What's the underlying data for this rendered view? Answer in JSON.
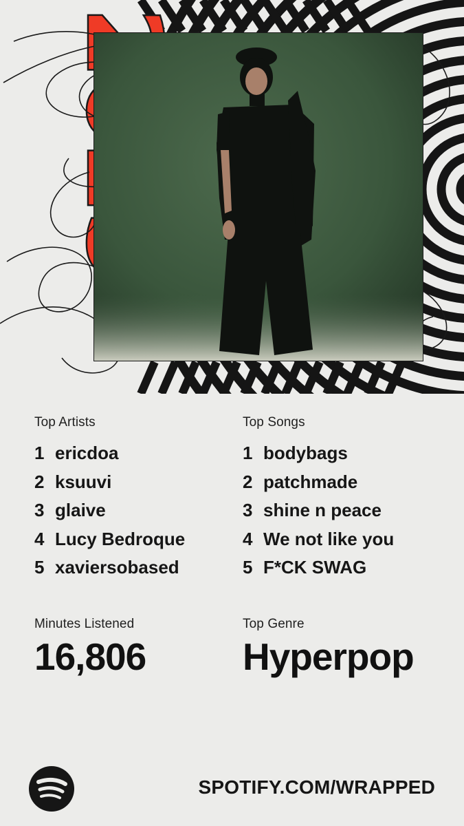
{
  "hero": {
    "year_graphic": "2025",
    "photo_alt": "Artist portrait"
  },
  "colors": {
    "background": "#ececea",
    "accent_red": "#ef3b26",
    "ink": "#161616",
    "photo_green": "#3d5a3f"
  },
  "top_artists": {
    "label": "Top Artists",
    "items": [
      {
        "rank": "1",
        "name": "ericdoa"
      },
      {
        "rank": "2",
        "name": "ksuuvi"
      },
      {
        "rank": "3",
        "name": "glaive"
      },
      {
        "rank": "4",
        "name": "Lucy Bedroque"
      },
      {
        "rank": "5",
        "name": "xaviersobased"
      }
    ]
  },
  "top_songs": {
    "label": "Top Songs",
    "items": [
      {
        "rank": "1",
        "name": "bodybags"
      },
      {
        "rank": "2",
        "name": "patchmade"
      },
      {
        "rank": "3",
        "name": "shine n peace"
      },
      {
        "rank": "4",
        "name": "We not like you"
      },
      {
        "rank": "5",
        "name": "F*CK SWAG"
      }
    ]
  },
  "minutes": {
    "label": "Minutes Listened",
    "value": "16,806"
  },
  "genre": {
    "label": "Top Genre",
    "value": "Hyperpop"
  },
  "footer": {
    "logo_icon": "spotify-logo-icon",
    "url": "SPOTIFY.COM/WRAPPED"
  }
}
